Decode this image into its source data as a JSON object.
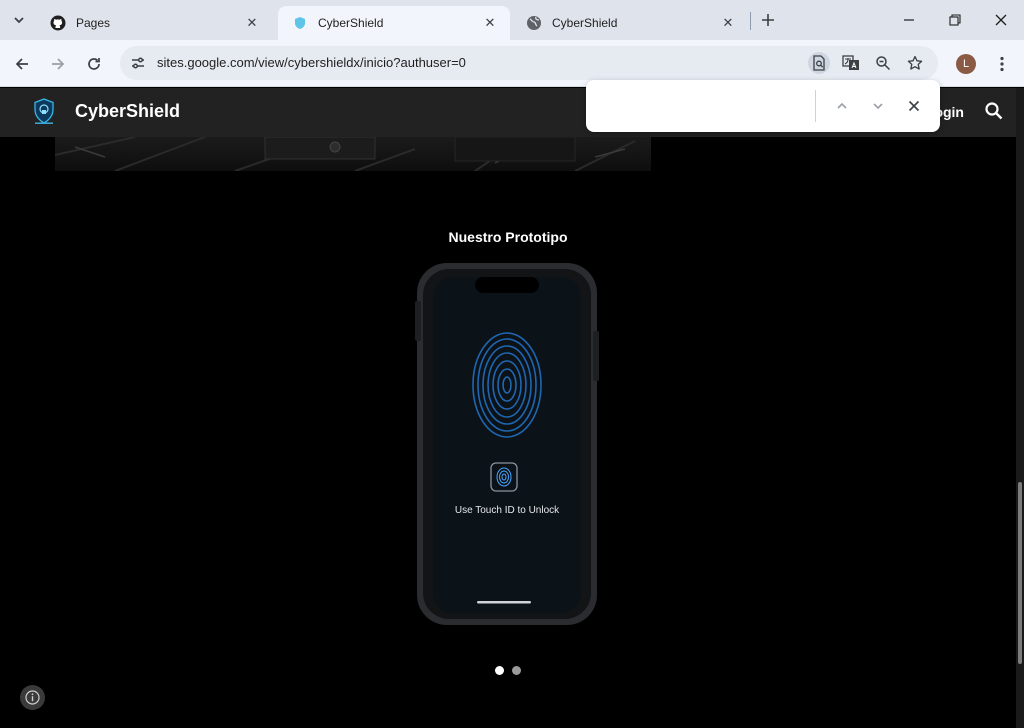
{
  "browser": {
    "tabs": [
      {
        "title": "Pages",
        "icon": "github-icon",
        "active": false
      },
      {
        "title": "CyberShield",
        "icon": "site-favicon",
        "active": true
      },
      {
        "title": "CyberShield",
        "icon": "globe-icon",
        "active": false
      }
    ],
    "url": "sites.google.com/view/cybershieldx/inicio?authuser=0",
    "profile_initial": "L"
  },
  "find_bar": {
    "query": "",
    "placeholder": ""
  },
  "site": {
    "title": "CyberShield",
    "login_label": "Login",
    "section_title": "Nuestro Prototipo",
    "phone_screen_text": "Use Touch ID to Unlock",
    "carousel": {
      "count": 2,
      "active_index": 0
    }
  },
  "colors": {
    "header_bg": "#222222",
    "page_bg": "#000000",
    "fingerprint": "#2d8ce6"
  }
}
